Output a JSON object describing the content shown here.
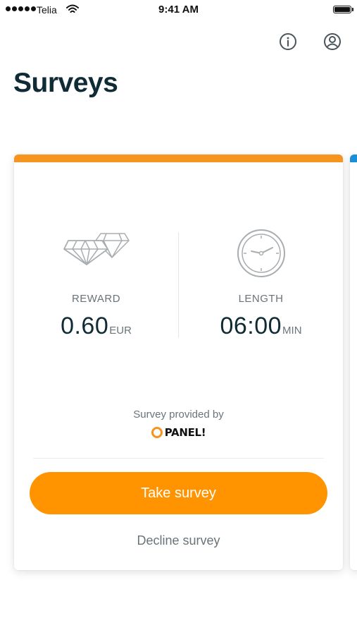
{
  "status_bar": {
    "carrier": "Telia",
    "time": "9:41 AM"
  },
  "header": {
    "title": "Surveys",
    "icons": [
      "info-icon",
      "profile-icon"
    ]
  },
  "survey_card": {
    "accent_color": "#f7941e",
    "reward": {
      "label": "REWARD",
      "value": "0.60",
      "unit": "EUR",
      "icon": "diamond-icon"
    },
    "length": {
      "label": "LENGTH",
      "value": "06:00",
      "unit": "MIN",
      "icon": "clock-icon"
    },
    "provided_by_label": "Survey provided by",
    "provider_name": "PANEL!",
    "take_survey_label": "Take survey",
    "decline_survey_label": "Decline survey"
  },
  "next_card": {
    "accent_color": "#1a8fd8"
  },
  "colors": {
    "primary_button": "#ff9400",
    "title_text": "#0f2c36",
    "muted_text": "#6a7378"
  }
}
